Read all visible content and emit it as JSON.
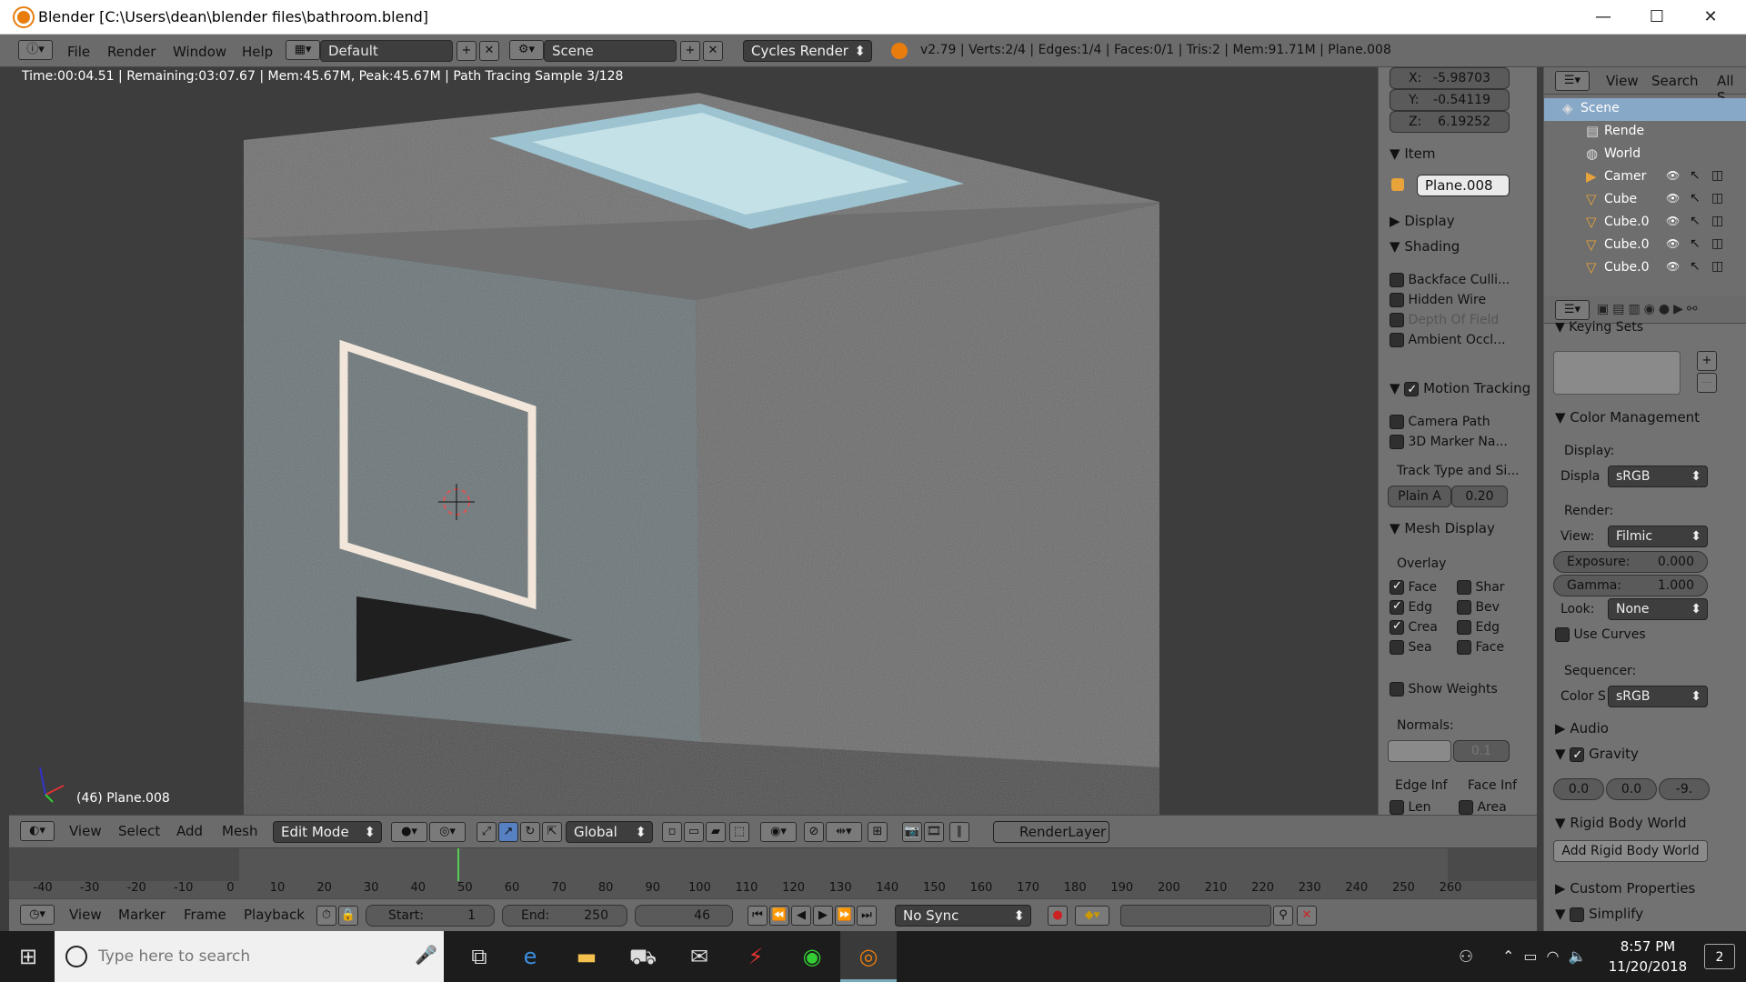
{
  "window": {
    "title": "Blender [C:\\Users\\dean\\blender files\\bathroom.blend]",
    "min": "—",
    "max": "☐",
    "close": "✕"
  },
  "info_header": {
    "menus": [
      "File",
      "Render",
      "Window",
      "Help"
    ],
    "layout": "Default",
    "scene": "Scene",
    "engine": "Cycles Render",
    "stats": "v2.79 | Verts:2/4 | Edges:1/4 | Faces:0/1 | Tris:2 | Mem:91.71M | Plane.008"
  },
  "viewport": {
    "render_status": "Time:00:04.51 | Remaining:03:07.67 | Mem:45.67M, Peak:45.67M | Path Tracing Sample 3/128",
    "object_label": "(46) Plane.008"
  },
  "npanel": {
    "coords": [
      {
        "axis": "X:",
        "value": "-5.98703"
      },
      {
        "axis": "Y:",
        "value": "-0.54119"
      },
      {
        "axis": "Z:",
        "value": "6.19252"
      }
    ],
    "item_title": "Item",
    "item_name": "Plane.008",
    "display_title": "Display",
    "shading_title": "Shading",
    "shading": [
      {
        "label": "Backface Culli...",
        "checked": false,
        "dim": false
      },
      {
        "label": "Hidden Wire",
        "checked": false,
        "dim": false
      },
      {
        "label": "Depth Of Field",
        "checked": false,
        "dim": true
      },
      {
        "label": "Ambient Occl...",
        "checked": false,
        "dim": false
      }
    ],
    "motion_title": "Motion Tracking",
    "motion": [
      {
        "label": "Camera Path",
        "checked": false
      },
      {
        "label": "3D Marker Na...",
        "checked": false
      }
    ],
    "track_type_label": "Track Type and Si...",
    "track_type_value": "Plain A",
    "track_size": "0.20",
    "mesh_title": "Mesh Display",
    "overlay_label": "Overlay",
    "overlay_left": [
      {
        "label": "Face",
        "checked": true
      },
      {
        "label": "Edg",
        "checked": true
      },
      {
        "label": "Crea",
        "checked": true
      },
      {
        "label": "Sea",
        "checked": false
      }
    ],
    "overlay_right": [
      {
        "label": "Shar",
        "checked": false
      },
      {
        "label": "Bev",
        "checked": false
      },
      {
        "label": "Edg",
        "checked": false
      },
      {
        "label": "Face",
        "checked": false
      }
    ],
    "show_weights": "Show Weights",
    "normals_label": "Normals:",
    "normals_size": "0.1",
    "edge_info": "Edge Inf",
    "face_info": "Face Inf",
    "len": "Len",
    "area": "Area"
  },
  "outliner": {
    "menus": [
      "View",
      "Search",
      "All S"
    ],
    "items": [
      {
        "name": "Scene",
        "indent": 0,
        "icon": "scene-icon"
      },
      {
        "name": "Rende",
        "indent": 1,
        "icon": "render-layers-icon"
      },
      {
        "name": "World",
        "indent": 1,
        "icon": "world-icon"
      },
      {
        "name": "Camer",
        "indent": 1,
        "icon": "camera-icon"
      },
      {
        "name": "Cube",
        "indent": 1,
        "icon": "mesh-icon"
      },
      {
        "name": "Cube.0",
        "indent": 1,
        "icon": "mesh-icon"
      },
      {
        "name": "Cube.0",
        "indent": 1,
        "icon": "mesh-icon"
      },
      {
        "name": "Cube.0",
        "indent": 1,
        "icon": "mesh-icon"
      }
    ]
  },
  "props": {
    "keying_sets": "Keying Sets",
    "color_mgmt": "Color Management",
    "display_label": "Display:",
    "display_device_label": "Displa",
    "display_device": "sRGB",
    "render_label": "Render:",
    "view_label": "View:",
    "view_value": "Filmic",
    "exposure_label": "Exposure:",
    "exposure_value": "0.000",
    "gamma_label": "Gamma:",
    "gamma_value": "1.000",
    "look_label": "Look:",
    "look_value": "None",
    "use_curves": "Use Curves",
    "sequencer_label": "Sequencer:",
    "colorspace_label": "Color S",
    "colorspace_value": "sRGB",
    "audio": "Audio",
    "gravity": "Gravity",
    "gravity_values": [
      "0.0",
      "0.0",
      "-9."
    ],
    "rigid_body_world": "Rigid Body World",
    "add_rigid_body_world": "Add Rigid Body World",
    "custom_properties": "Custom Properties",
    "simplify": "Simplify"
  },
  "view3d_header": {
    "menus": [
      "View",
      "Select",
      "Add",
      "Mesh"
    ],
    "mode": "Edit Mode",
    "orientation": "Global",
    "render_layer": "RenderLayer"
  },
  "timeline": {
    "ticks": [
      "-40",
      "-30",
      "-20",
      "-10",
      "0",
      "10",
      "20",
      "30",
      "40",
      "50",
      "60",
      "70",
      "80",
      "90",
      "100",
      "110",
      "120",
      "130",
      "140",
      "150",
      "160",
      "170",
      "180",
      "190",
      "200",
      "210",
      "220",
      "230",
      "240",
      "250",
      "260"
    ],
    "current_frame": 46
  },
  "timeline_header": {
    "menus": [
      "View",
      "Marker",
      "Frame",
      "Playback"
    ],
    "start_label": "Start:",
    "start_value": "1",
    "end_label": "End:",
    "end_value": "250",
    "current": "46",
    "sync": "No Sync"
  },
  "taskbar": {
    "search_placeholder": "Type here to search",
    "time": "8:57 PM",
    "date": "11/20/2018",
    "notifications": "2"
  }
}
